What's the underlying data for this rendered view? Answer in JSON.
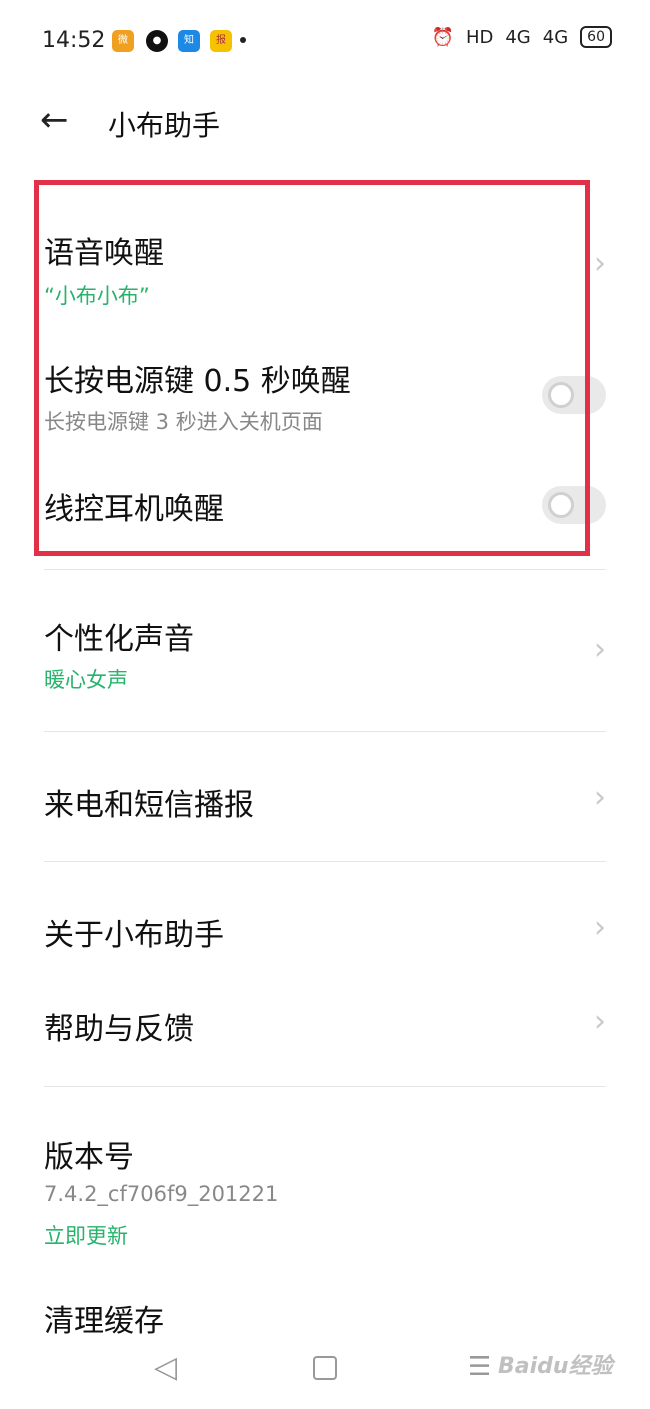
{
  "status_bar": {
    "time": "14:52",
    "app_icons": [
      {
        "name": "weibo-icon",
        "color": "#f0a020",
        "glyph": "微"
      },
      {
        "name": "app-black-icon",
        "color": "#111111",
        "glyph": "●"
      },
      {
        "name": "zhihu-icon",
        "color": "#1e88e5",
        "glyph": "知"
      },
      {
        "name": "news-icon",
        "color": "#f6c200",
        "glyph": "报"
      }
    ],
    "alarm": "⏰",
    "wifi": "HD",
    "signal1": "4G",
    "signal2": "4G",
    "battery": "60"
  },
  "header": {
    "back": "←",
    "title": "小布助手"
  },
  "settings": {
    "voice_wake": {
      "title": "语音唤醒",
      "subtitle": "“小布小布”"
    },
    "power_key_wake": {
      "title": "长按电源键 0.5 秒唤醒",
      "subtitle": "长按电源键 3 秒进入关机页面",
      "enabled": false
    },
    "headset_wake": {
      "title": "线控耳机唤醒",
      "enabled": false
    },
    "personal_voice": {
      "title": "个性化声音",
      "subtitle": "暖心女声"
    },
    "call_sms_broadcast": {
      "title": "来电和短信播报"
    },
    "about": {
      "title": "关于小布助手"
    },
    "help": {
      "title": "帮助与反馈"
    },
    "version": {
      "title": "版本号",
      "value": "7.4.2_cf706f9_201221",
      "update": "立即更新"
    },
    "clear_cache": {
      "title": "清理缓存"
    }
  },
  "chevron": "›",
  "highlight_color": "#e03148",
  "accent_color": "#27b36c",
  "navbar": {
    "back": "◁",
    "menu": "☰"
  },
  "watermark": "Baidu经验"
}
